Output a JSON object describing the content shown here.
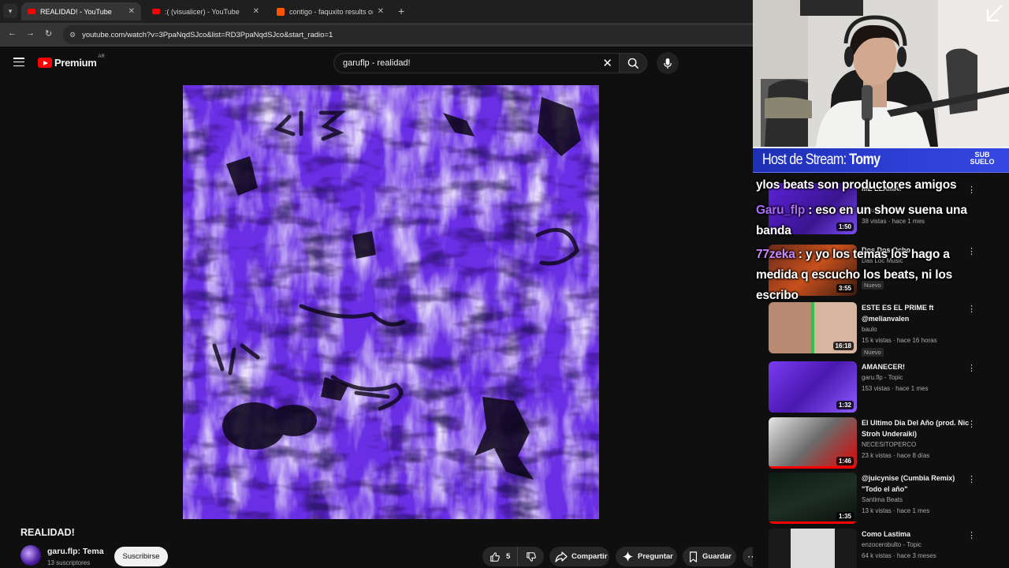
{
  "browser": {
    "tabs": [
      {
        "title": "REALIDAD! - YouTube",
        "active": true
      },
      {
        "title": ":( (visualicer) - YouTube",
        "active": false
      },
      {
        "title": "contigo - faquxito results on So",
        "active": false
      }
    ],
    "url": "youtube.com/watch?v=3PpaNqdSJco&list=RD3PpaNqdSJco&start_radio=1"
  },
  "header": {
    "logo": "Premium",
    "region": "AR",
    "search_query": "garuflp - realidad!"
  },
  "video": {
    "title": "REALIDAD!",
    "channel": "garu.flp: Tema",
    "subscribers": "13 suscriptores",
    "subscribe_label": "Suscribirse",
    "likes": "5",
    "share_label": "Compartir",
    "ask_label": "Preguntar",
    "save_label": "Guardar"
  },
  "stream": {
    "host_prefix": "Host de Stream:",
    "host_name": "Tomy",
    "logo": "SUB SUELO"
  },
  "chat": [
    {
      "user": "",
      "text": "ylos beats son productores amigos"
    },
    {
      "user": "Garu_flp",
      "text": ": eso en un show suena una"
    },
    {
      "user": "",
      "text": "banda"
    },
    {
      "user": "77zeka",
      "text": ": y yo los temas los hago a"
    },
    {
      "user": "",
      "text": "medida q escucho los beats, ni los"
    },
    {
      "user": "",
      "text": "escribo"
    }
  ],
  "recommendations": [
    {
      "title": "ME LLAMA!",
      "channel": "garu.flp - Topic",
      "meta": "38 vistas · hace 1 mes",
      "duration": "1:50",
      "badge": ""
    },
    {
      "title": "Dos Dos Ocho",
      "channel": "Das Loc Music",
      "meta": "",
      "duration": "3:55",
      "badge": "Nuevo"
    },
    {
      "title": "ESTE ES EL PRIME ft @melianvalen",
      "channel": "baulo",
      "meta": "15 k vistas · hace 16 horas",
      "duration": "16:18",
      "badge": "Nuevo"
    },
    {
      "title": "AMANECER!",
      "channel": "garu.flp - Topic",
      "meta": "153 vistas · hace 1 mes",
      "duration": "1:32",
      "badge": ""
    },
    {
      "title": "El Ultimo Dia Del Año (prod. Nic Stroh Underaiki)",
      "channel": "NECESITOPERCO",
      "meta": "23 k vistas · hace 8 días",
      "duration": "1:46",
      "badge": ""
    },
    {
      "title": "@juicynise (Cumbia Remix) \"Todo el año\"",
      "channel": "Santima Beats",
      "meta": "13 k vistas · hace 1 mes",
      "duration": "1:35",
      "badge": ""
    },
    {
      "title": "Como Lastima",
      "channel": "enzocerobulto - Topic",
      "meta": "64 k vistas · hace 3 meses",
      "duration": "",
      "badge": ""
    }
  ],
  "colors": {
    "accent_red": "#ff0000",
    "banner_blue": "#2e3fd6",
    "chat_user": "#b06bff"
  }
}
